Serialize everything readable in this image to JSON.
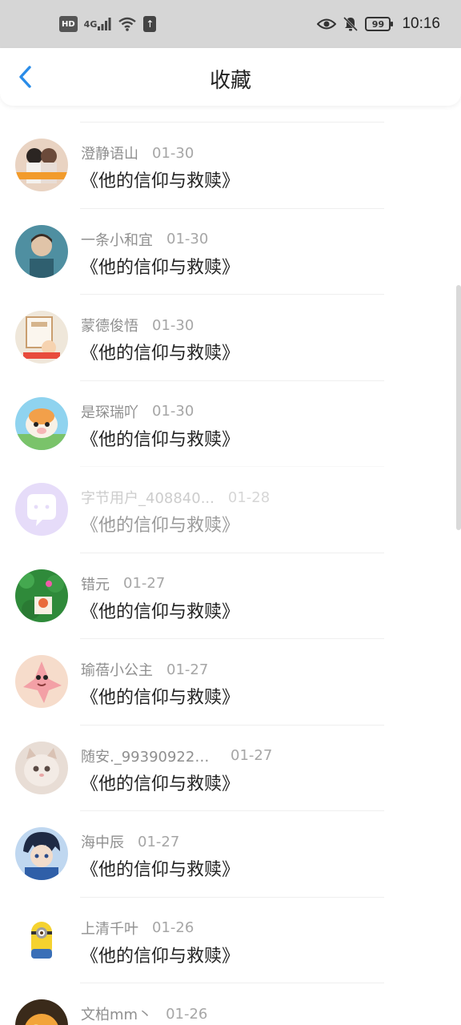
{
  "status_bar": {
    "hd": "HD",
    "network": "4G",
    "battery": "99",
    "time": "10:16",
    "icons": [
      "hd-icon",
      "signal-icon",
      "wifi-icon",
      "upload-icon",
      "eye-icon",
      "bell-off-icon",
      "battery-icon"
    ]
  },
  "header": {
    "back_icon": "chevron-left-icon",
    "title": "收藏",
    "accent_color": "#2a8ce8"
  },
  "items": [
    {
      "user": "澄静语山",
      "date": "01-30",
      "title": "《他的信仰与救赎》",
      "avatar": "avatar-couple-photo"
    },
    {
      "user": "一条小和宜",
      "date": "01-30",
      "title": "《他的信仰与救赎》",
      "avatar": "avatar-portrait-teal"
    },
    {
      "user": "蒙德俊悟",
      "date": "01-30",
      "title": "《他的信仰与救赎》",
      "avatar": "avatar-cartoon-cards"
    },
    {
      "user": "是琛瑞吖",
      "date": "01-30",
      "title": "《他的信仰与救赎》",
      "avatar": "avatar-hamster"
    },
    {
      "user": "字节用户_408840...",
      "date": "01-28",
      "title": "《他的信仰与救赎》",
      "avatar": "avatar-default-chat",
      "dimmed": true
    },
    {
      "user": "错元",
      "date": "01-27",
      "title": "《他的信仰与救赎》",
      "avatar": "avatar-green-flowers"
    },
    {
      "user": "瑜蓓小公主",
      "date": "01-27",
      "title": "《他的信仰与救赎》",
      "avatar": "avatar-patrick-star"
    },
    {
      "user": "随安._993909222...",
      "date": "01-27",
      "title": "《他的信仰与救赎》",
      "avatar": "avatar-kitten"
    },
    {
      "user": "海中辰",
      "date": "01-27",
      "title": "《他的信仰与救赎》",
      "avatar": "avatar-anime-boy"
    },
    {
      "user": "上清千叶",
      "date": "01-26",
      "title": "《他的信仰与救赎》",
      "avatar": "avatar-minion"
    },
    {
      "user": "文柏mm丶",
      "date": "01-26",
      "title": "",
      "avatar": "avatar-orange"
    }
  ]
}
